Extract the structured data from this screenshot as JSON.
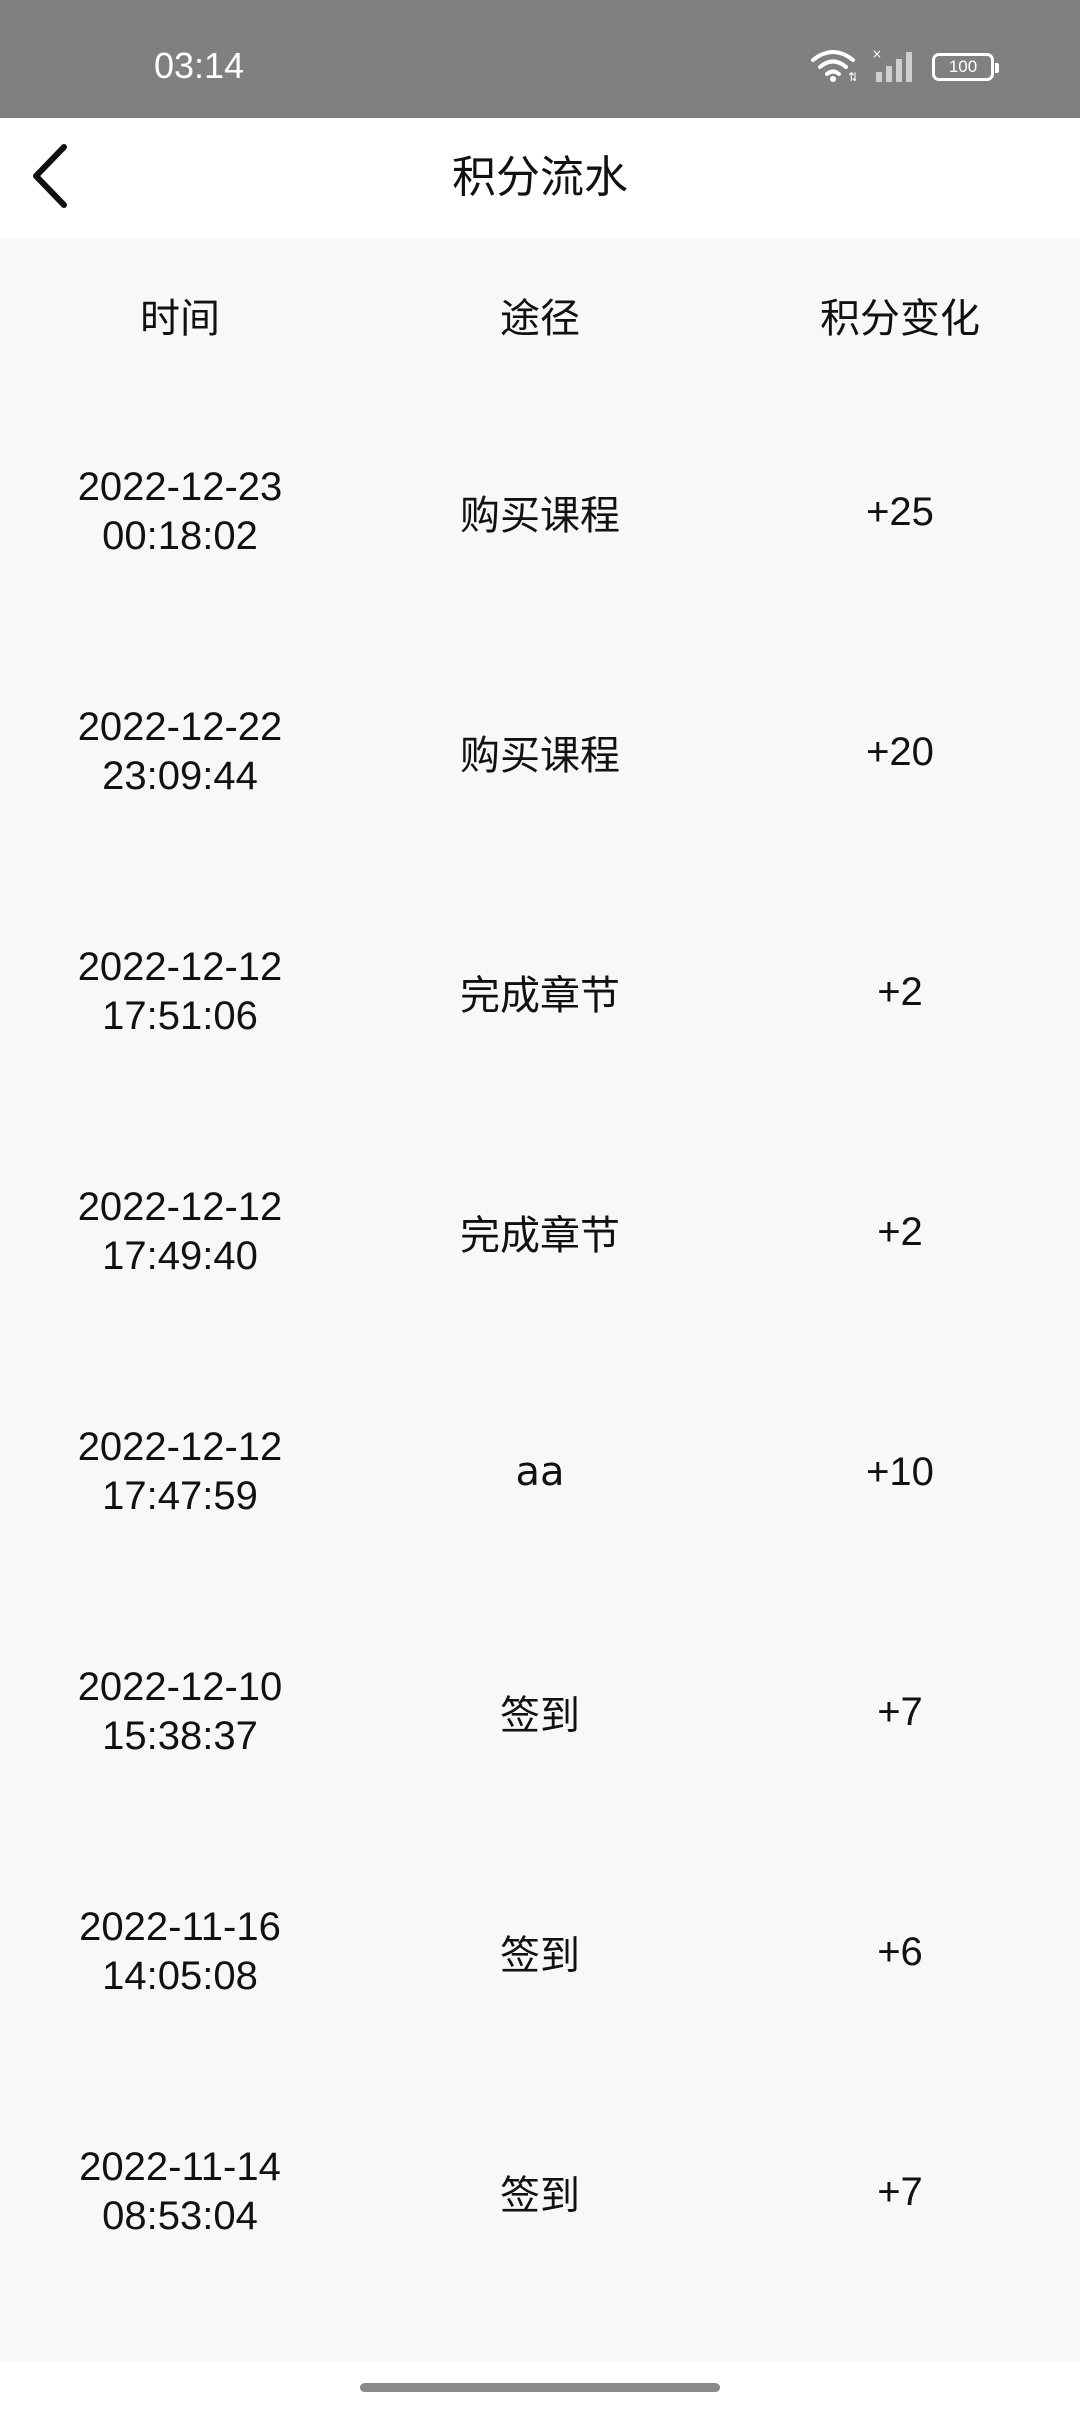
{
  "status_bar": {
    "time": "03:14",
    "battery": "100",
    "icons": [
      "wifi-icon",
      "signal-icon",
      "battery-icon"
    ]
  },
  "header": {
    "title": "积分流水",
    "back_icon": "chevron-left-icon"
  },
  "table": {
    "columns": [
      "时间",
      "途径",
      "积分变化"
    ],
    "rows": [
      {
        "date": "2022-12-23",
        "time": "00:18:02",
        "source": "购买课程",
        "change": "+25"
      },
      {
        "date": "2022-12-22",
        "time": "23:09:44",
        "source": "购买课程",
        "change": "+20"
      },
      {
        "date": "2022-12-12",
        "time": "17:51:06",
        "source": "完成章节",
        "change": "+2"
      },
      {
        "date": "2022-12-12",
        "time": "17:49:40",
        "source": "完成章节",
        "change": "+2"
      },
      {
        "date": "2022-12-12",
        "time": "17:47:59",
        "source": "aa",
        "change": "+10"
      },
      {
        "date": "2022-12-10",
        "time": "15:38:37",
        "source": "签到",
        "change": "+7"
      },
      {
        "date": "2022-11-16",
        "time": "14:05:08",
        "source": "签到",
        "change": "+6"
      },
      {
        "date": "2022-11-14",
        "time": "08:53:04",
        "source": "签到",
        "change": "+7"
      }
    ]
  },
  "colors": {
    "status_bar_bg": "#808080",
    "page_bg": "#f8f8f8",
    "header_bg": "#ffffff",
    "text": "#111111"
  }
}
